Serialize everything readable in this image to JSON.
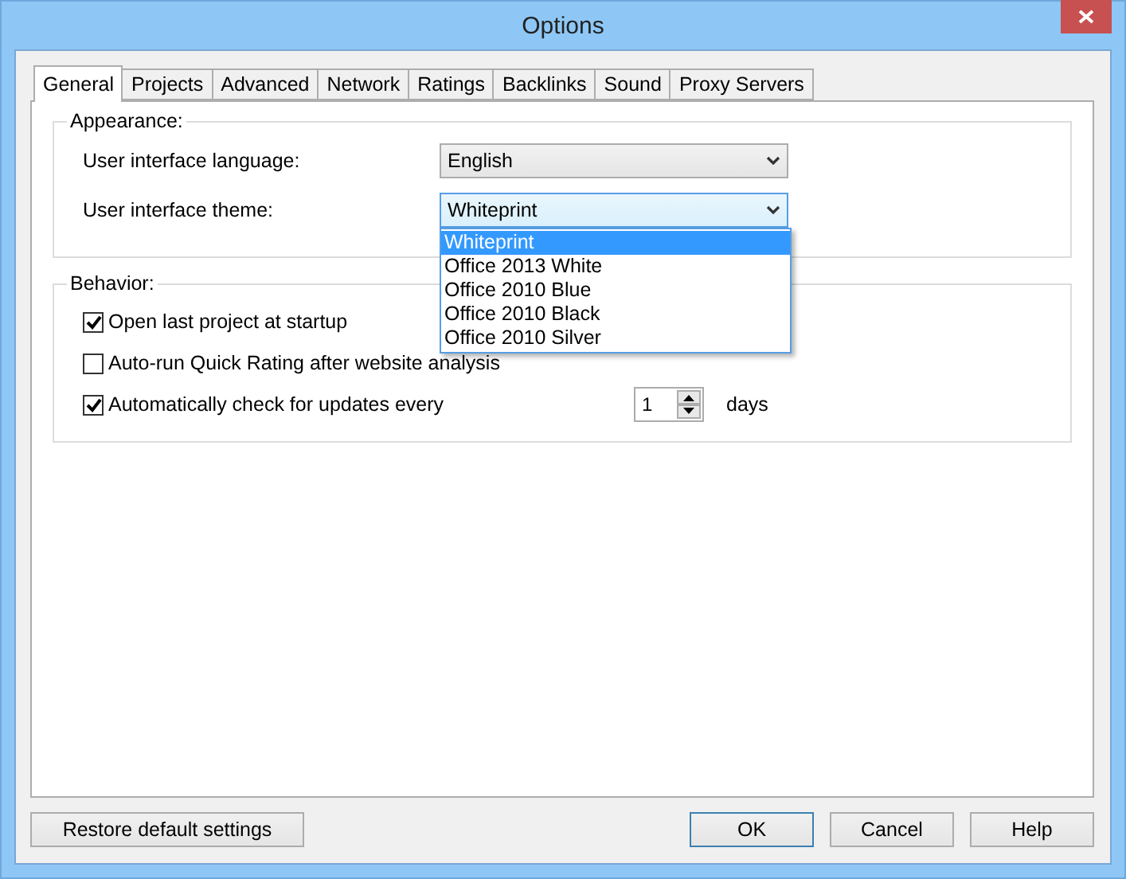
{
  "window": {
    "title": "Options"
  },
  "tabs": [
    {
      "label": "General",
      "selected": true
    },
    {
      "label": "Projects",
      "selected": false
    },
    {
      "label": "Advanced",
      "selected": false
    },
    {
      "label": "Network",
      "selected": false
    },
    {
      "label": "Ratings",
      "selected": false
    },
    {
      "label": "Backlinks",
      "selected": false
    },
    {
      "label": "Sound",
      "selected": false
    },
    {
      "label": "Proxy Servers",
      "selected": false
    }
  ],
  "appearance": {
    "title": "Appearance:",
    "fields": [
      {
        "label": "User interface language:",
        "value": "English",
        "expanded": false
      },
      {
        "label": "User interface theme:",
        "value": "Whiteprint",
        "expanded": true,
        "options": [
          {
            "label": "Whiteprint",
            "selected": true
          },
          {
            "label": "Office 2013 White",
            "selected": false
          },
          {
            "label": "Office 2010 Blue",
            "selected": false
          },
          {
            "label": "Office 2010 Black",
            "selected": false
          },
          {
            "label": "Office 2010 Silver",
            "selected": false
          }
        ]
      }
    ]
  },
  "behavior": {
    "title": "Behavior:",
    "options": [
      {
        "label": "Open last project at startup",
        "checked": true
      },
      {
        "label": "Auto-run Quick Rating after website analysis",
        "checked": false
      },
      {
        "label": "Automatically check for updates every",
        "checked": true,
        "spinner": {
          "value": "1",
          "unit": "days"
        }
      }
    ]
  },
  "buttons": [
    {
      "label": "Restore default settings",
      "default": false
    },
    {
      "label": "OK",
      "default": true
    },
    {
      "label": "Cancel",
      "default": false
    },
    {
      "label": "Help",
      "default": false
    }
  ]
}
